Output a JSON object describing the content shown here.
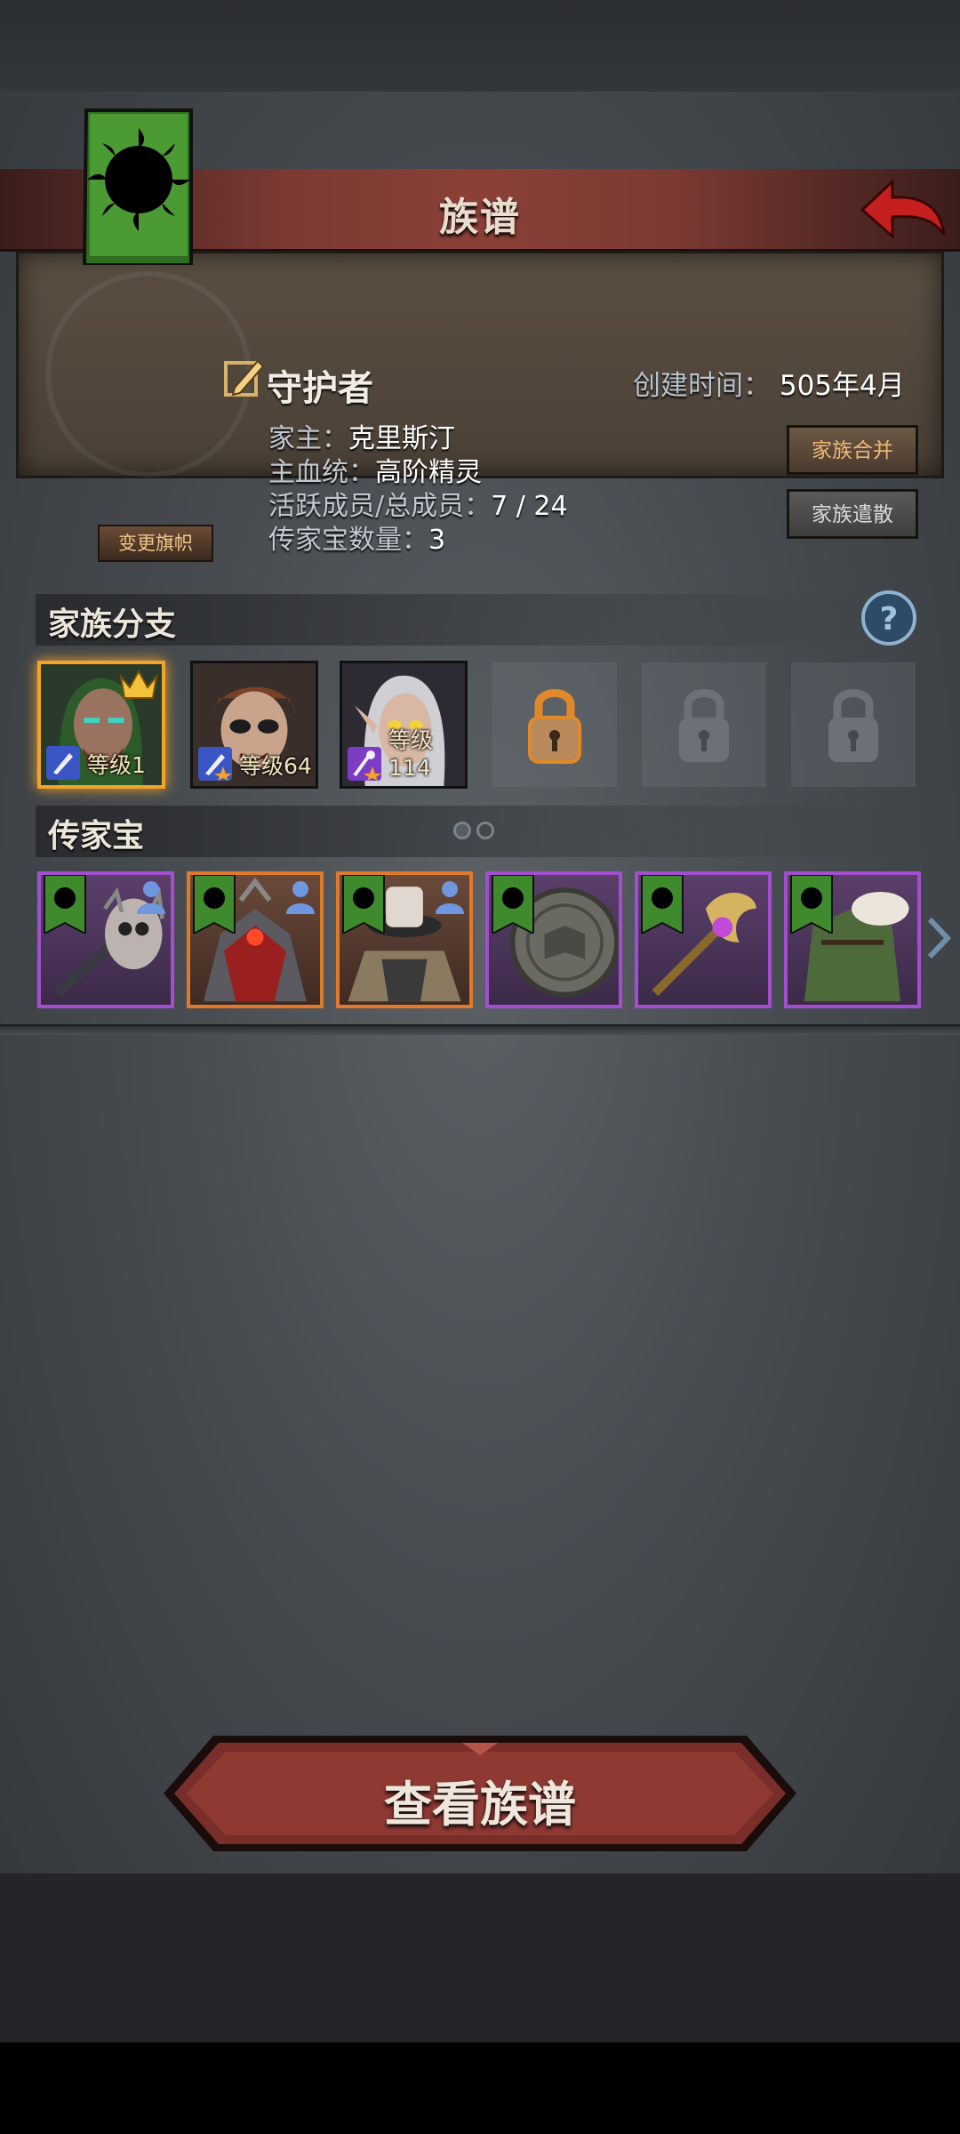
{
  "header": {
    "title": "族谱"
  },
  "family": {
    "name": "守护者",
    "created_label": "创建时间：",
    "created_value": "505年4月",
    "head_label": "家主：",
    "head_value": "克里斯汀",
    "bloodline_label": "主血统：",
    "bloodline_value": "高阶精灵",
    "members_label": "活跃成员/总成员：",
    "members_value": "7 / 24",
    "heirloom_count_label": "传家宝数量：",
    "heirloom_count_value": "3",
    "change_banner_label": "变更旗帜",
    "merge_label": "家族合并",
    "dissolve_label": "家族遣散",
    "banner_color": "#3f8a2c"
  },
  "branches_section": {
    "title": "家族分支",
    "items": [
      {
        "level": "等级1",
        "class_icon": "sword-icon",
        "selected": true,
        "crown": true
      },
      {
        "level": "等级64",
        "class_icon": "sword-star-icon",
        "selected": false,
        "crown": false
      },
      {
        "level": "等级114",
        "class_icon": "staff-star-icon",
        "selected": false,
        "crown": false
      }
    ],
    "locked_slots": 3
  },
  "heirloom_section": {
    "title": "传家宝",
    "items": [
      {
        "rarity": "epic",
        "icon": "skull-mace-icon",
        "owned_by_person": true
      },
      {
        "rarity": "legendary",
        "icon": "demon-armor-icon",
        "owned_by_person": true
      },
      {
        "rarity": "legendary",
        "icon": "hat-armor-icon",
        "owned_by_person": true
      },
      {
        "rarity": "epic",
        "icon": "shield-book-icon",
        "owned_by_person": false
      },
      {
        "rarity": "epic",
        "icon": "gold-mace-icon",
        "owned_by_person": false
      },
      {
        "rarity": "epic",
        "icon": "fur-coat-icon",
        "owned_by_person": false
      }
    ]
  },
  "view_button": {
    "label": "查看族谱"
  },
  "colors": {
    "accent_red": "#7b3a33",
    "epic": "#a24ecf",
    "legendary": "#e07a2a",
    "banner_green": "#3f8a2c"
  }
}
